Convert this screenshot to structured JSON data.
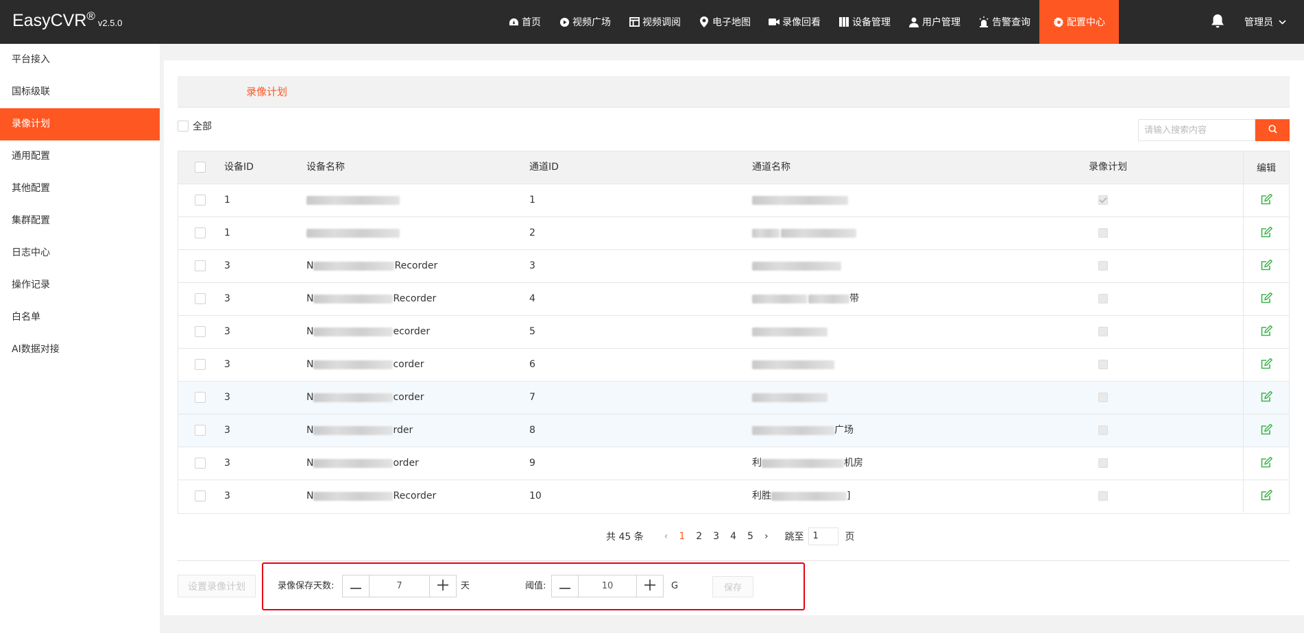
{
  "app": {
    "brand": "EasyCVR",
    "registered": "®",
    "version": "v2.5.0"
  },
  "nav": {
    "items": [
      {
        "label": "首页",
        "icon": "dashboard-icon"
      },
      {
        "label": "视频广场",
        "icon": "play-circle-icon"
      },
      {
        "label": "视频调阅",
        "icon": "grid-icon"
      },
      {
        "label": "电子地图",
        "icon": "map-pin-icon"
      },
      {
        "label": "录像回看",
        "icon": "video-camera-icon"
      },
      {
        "label": "设备管理",
        "icon": "server-icon"
      },
      {
        "label": "用户管理",
        "icon": "user-icon"
      },
      {
        "label": "告警查询",
        "icon": "alarm-icon"
      },
      {
        "label": "配置中心",
        "icon": "gear-icon",
        "active": true
      }
    ],
    "user": "管理员"
  },
  "sidebar": {
    "items": [
      {
        "label": "平台接入"
      },
      {
        "label": "国标级联"
      },
      {
        "label": "录像计划",
        "active": true
      },
      {
        "label": "通用配置"
      },
      {
        "label": "其他配置"
      },
      {
        "label": "集群配置"
      },
      {
        "label": "日志中心"
      },
      {
        "label": "操作记录"
      },
      {
        "label": "白名单"
      },
      {
        "label": "AI数据对接"
      }
    ]
  },
  "main": {
    "tab": "录像计划",
    "select_all": "全部",
    "search_placeholder": "请输入搜索内容"
  },
  "table": {
    "headers": {
      "device_id": "设备ID",
      "device_name": "设备名称",
      "channel_id": "通道ID",
      "channel_name": "通道名称",
      "plan": "录像计划",
      "edit": "编辑"
    },
    "rows": [
      {
        "device_id": "1",
        "device_name_prefix": "",
        "device_name_suffix": "",
        "channel_id": "1",
        "channel_prefix": "",
        "channel_suffix": "",
        "plan": true
      },
      {
        "device_id": "1",
        "device_name_prefix": "",
        "device_name_suffix": "",
        "channel_id": "2",
        "channel_prefix": "",
        "channel_suffix": "",
        "plan": false
      },
      {
        "device_id": "3",
        "device_name_prefix": "N",
        "device_name_suffix": "Recorder",
        "channel_id": "3",
        "channel_prefix": "",
        "channel_suffix": "",
        "plan": false
      },
      {
        "device_id": "3",
        "device_name_prefix": "N",
        "device_name_suffix": "Recorder",
        "channel_id": "4",
        "channel_prefix": "",
        "channel_suffix": "带",
        "plan": false
      },
      {
        "device_id": "3",
        "device_name_prefix": "N",
        "device_name_suffix": "ecorder",
        "channel_id": "5",
        "channel_prefix": "",
        "channel_suffix": "",
        "plan": false
      },
      {
        "device_id": "3",
        "device_name_prefix": "N",
        "device_name_suffix": "corder",
        "channel_id": "6",
        "channel_prefix": "",
        "channel_suffix": "",
        "plan": false
      },
      {
        "device_id": "3",
        "device_name_prefix": "N",
        "device_name_suffix": "corder",
        "channel_id": "7",
        "channel_prefix": "",
        "channel_suffix": "",
        "plan": false
      },
      {
        "device_id": "3",
        "device_name_prefix": "N",
        "device_name_suffix": "rder",
        "channel_id": "8",
        "channel_prefix": "",
        "channel_suffix": "广场",
        "plan": false
      },
      {
        "device_id": "3",
        "device_name_prefix": "N",
        "device_name_suffix": "order",
        "channel_id": "9",
        "channel_prefix": "利",
        "channel_suffix": "机房",
        "plan": false
      },
      {
        "device_id": "3",
        "device_name_prefix": "N",
        "device_name_suffix": "Recorder",
        "channel_id": "10",
        "channel_prefix": "利胜",
        "channel_suffix": "]",
        "plan": false
      }
    ]
  },
  "pagination": {
    "total": "共 45 条",
    "pages": [
      "1",
      "2",
      "3",
      "4",
      "5"
    ],
    "current": "1",
    "jump_label": "跳至",
    "jump_value": "1",
    "page_unit": "页"
  },
  "settings": {
    "set_plan_button": "设置录像计划",
    "retention_label": "录像保存天数:",
    "retention_value": "7",
    "retention_unit": "天",
    "threshold_label": "阈值:",
    "threshold_value": "10",
    "threshold_unit": "G",
    "save_button": "保存"
  },
  "colors": {
    "accent": "#ff5722",
    "topbar": "#2b2b2b",
    "edit_icon": "#3cb44b",
    "highlight": "#e60012"
  }
}
